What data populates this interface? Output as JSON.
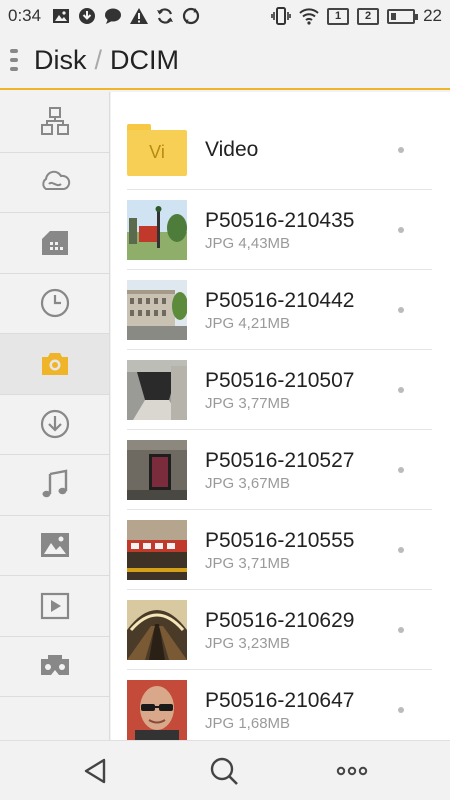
{
  "status_bar": {
    "time": "0:34",
    "sim1": "1",
    "sim2": "2",
    "battery_level": "22",
    "left_icons": [
      "image-notification-icon",
      "download-notification-icon",
      "chat-icon",
      "warning-icon",
      "sync-icon",
      "sync-alt-icon"
    ],
    "right_icons": [
      "vibrate-icon",
      "wifi-icon",
      "sim1-icon",
      "sim2-icon",
      "battery-icon"
    ]
  },
  "title_bar": {
    "root": "Disk",
    "separator": "/",
    "current": "DCIM"
  },
  "sidebar": {
    "items": [
      {
        "icon": "network-icon",
        "active": false
      },
      {
        "icon": "cloud-icon",
        "active": false
      },
      {
        "icon": "sd-card-icon",
        "active": false
      },
      {
        "icon": "recent-clock-icon",
        "active": false
      },
      {
        "icon": "camera-icon",
        "active": true
      },
      {
        "icon": "download-icon",
        "active": false
      },
      {
        "icon": "music-icon",
        "active": false
      },
      {
        "icon": "picture-icon",
        "active": false
      },
      {
        "icon": "video-icon",
        "active": false
      },
      {
        "icon": "vr-glasses-icon",
        "active": false
      }
    ]
  },
  "files": [
    {
      "name": "Video",
      "meta": "",
      "type": "folder",
      "folder_label": "Vi"
    },
    {
      "name": "P50516-210435",
      "meta": "JPG 4,43MB",
      "type": "image"
    },
    {
      "name": "P50516-210442",
      "meta": "JPG 4,21MB",
      "type": "image"
    },
    {
      "name": "P50516-210507",
      "meta": "JPG 3,77MB",
      "type": "image"
    },
    {
      "name": "P50516-210527",
      "meta": "JPG 3,67MB",
      "type": "image"
    },
    {
      "name": "P50516-210555",
      "meta": "JPG 3,71MB",
      "type": "image"
    },
    {
      "name": "P50516-210629",
      "meta": "JPG 3,23MB",
      "type": "image"
    },
    {
      "name": "P50516-210647",
      "meta": "JPG 1,68MB",
      "type": "image"
    }
  ],
  "bottom_bar": {
    "items": [
      "back-icon",
      "search-icon",
      "more-icon"
    ]
  },
  "colors": {
    "accent": "#f0b429",
    "folder": "#f8cf55",
    "background": "#f2f2f2"
  }
}
